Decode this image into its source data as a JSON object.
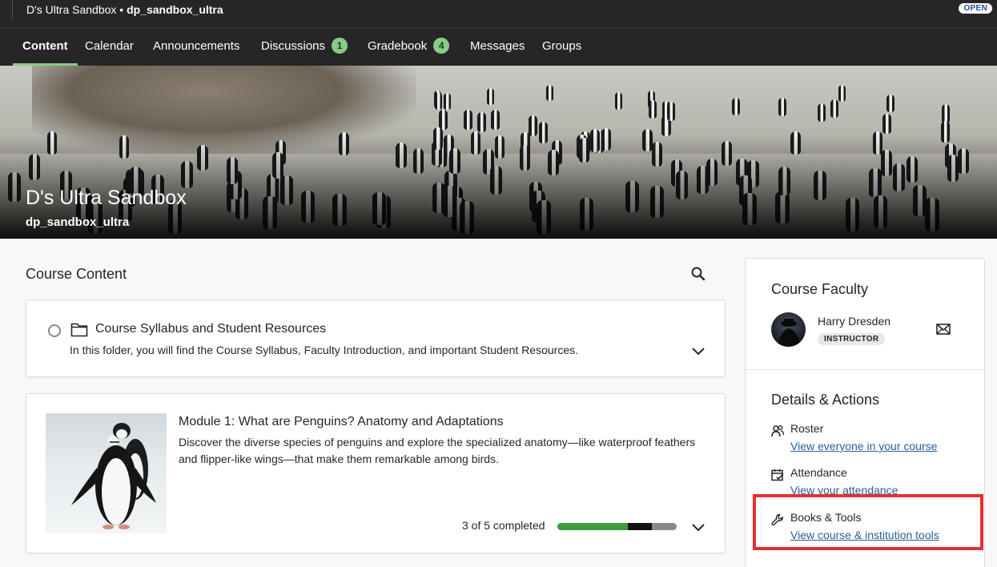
{
  "topbar": {
    "course_name": "D's Ultra Sandbox",
    "separator": " • ",
    "course_code": "dp_sandbox_ultra",
    "status_badge": "OPEN"
  },
  "nav": {
    "tabs": [
      {
        "label": "Content",
        "badge": null,
        "active": true
      },
      {
        "label": "Calendar",
        "badge": null
      },
      {
        "label": "Announcements",
        "badge": null
      },
      {
        "label": "Discussions",
        "badge": "1"
      },
      {
        "label": "Gradebook",
        "badge": "4"
      },
      {
        "label": "Messages",
        "badge": null
      },
      {
        "label": "Groups",
        "badge": null
      }
    ]
  },
  "banner": {
    "course_name": "D's Ultra Sandbox",
    "course_code": "dp_sandbox_ultra"
  },
  "main": {
    "section_title": "Course Content",
    "items": [
      {
        "title": "Course Syllabus and Student Resources",
        "description": "In this folder, you will find the Course Syllabus, Faculty Introduction, and important Student Resources."
      },
      {
        "title": "Module 1: What are Penguins? Anatomy and Adaptations",
        "description": "Discover the diverse species of penguins and explore the specialized anatomy—like waterproof feathers and flipper-like wings—that make them remarkable among birds.",
        "progress_text": "3 of 5 completed",
        "progress_completed": 3,
        "progress_total": 5
      }
    ]
  },
  "side": {
    "faculty_heading": "Course Faculty",
    "faculty_name": "Harry Dresden",
    "faculty_role": "INSTRUCTOR",
    "details_heading": "Details & Actions",
    "actions": [
      {
        "title": "Roster",
        "link": "View everyone in your course"
      },
      {
        "title": "Attendance",
        "link": "View your attendance"
      },
      {
        "title": "Books & Tools",
        "link": "View course & institution tools"
      }
    ]
  },
  "colors": {
    "accent_green": "#8acb88",
    "progress_green": "#3e9b3e",
    "link_blue": "#2b5d9a",
    "highlight_red": "#e03131",
    "dark_bar": "#262626"
  },
  "icons": [
    "search-icon",
    "folder-icon",
    "chevron-down-icon",
    "mail-icon",
    "roster-icon",
    "attendance-icon",
    "wrench-icon"
  ]
}
